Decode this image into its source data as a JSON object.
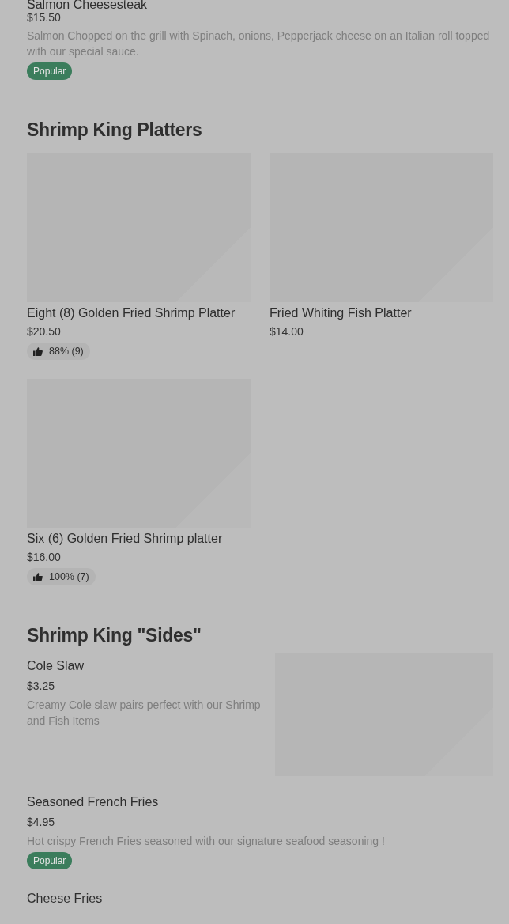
{
  "top_item": {
    "name": "Salmon Cheesesteak",
    "price": "$15.50",
    "description": "Salmon Chopped on the grill with Spinach, onions, Pepperjack cheese on an Italian roll topped with our special sauce.",
    "badge": "Popular"
  },
  "sections": [
    {
      "title": "Shrimp King Platters",
      "kind": "grid",
      "items": [
        {
          "name": "Eight (8) Golden Fried Shrimp Platter",
          "price": "$20.50",
          "rating": "88% (9)"
        },
        {
          "name": "Fried Whiting Fish Platter",
          "price": "$14.00"
        },
        {
          "name": "Six (6) Golden Fried Shrimp platter",
          "price": "$16.00",
          "rating": "100% (7)"
        }
      ]
    },
    {
      "title": "Shrimp King \"Sides\"",
      "kind": "list",
      "items": [
        {
          "name": "Cole Slaw",
          "price": "$3.25",
          "description": "Creamy Cole slaw pairs perfect with our Shrimp and Fish Items",
          "image": true
        },
        {
          "name": "Seasoned French Fries",
          "price": "$4.95",
          "description": "Hot crispy French Fries seasoned with our signature seafood seasoning !",
          "badge": "Popular"
        },
        {
          "name": "Cheese Fries"
        }
      ]
    }
  ]
}
